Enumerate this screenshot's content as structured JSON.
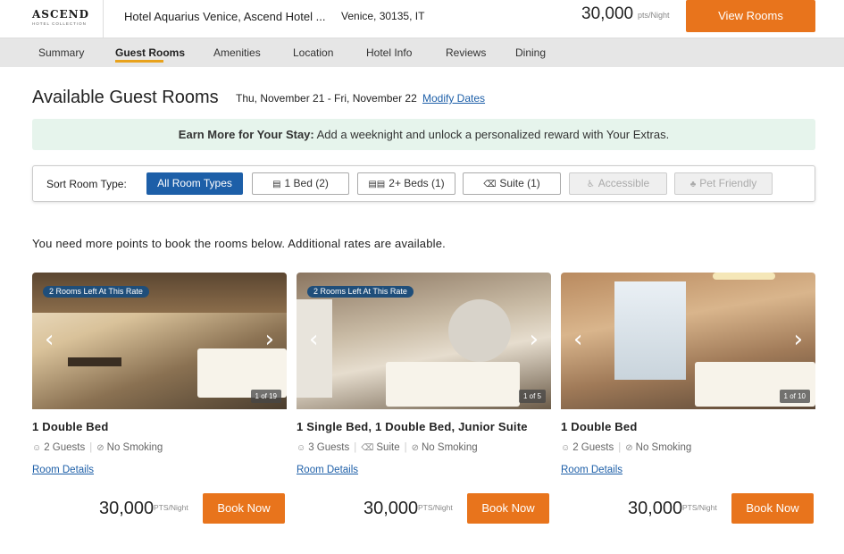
{
  "header": {
    "logo_main": "ASCEND",
    "logo_sub": "HOTEL COLLECTION",
    "hotel_name": "Hotel Aquarius Venice, Ascend Hotel ...",
    "location": "Venice, 30135, IT",
    "points": "30,000",
    "points_unit": "pts/Night",
    "view_rooms_label": "View Rooms"
  },
  "nav": {
    "items": [
      {
        "label": "Summary",
        "active": false
      },
      {
        "label": "Guest Rooms",
        "active": true
      },
      {
        "label": "Amenities",
        "active": false
      },
      {
        "label": "Location",
        "active": false
      },
      {
        "label": "Hotel Info",
        "active": false
      },
      {
        "label": "Reviews",
        "active": false
      },
      {
        "label": "Dining",
        "active": false
      }
    ]
  },
  "main": {
    "title": "Available Guest Rooms",
    "dates": "Thu, November 21 - Fri, November 22",
    "modify_dates": "Modify Dates",
    "banner_bold": "Earn More for Your Stay:",
    "banner_text": " Add a weeknight and unlock a personalized reward with Your Extras.",
    "sort_label": "Sort Room Type:",
    "filters": [
      {
        "label": "All Room Types",
        "icon": "",
        "state": "active"
      },
      {
        "label": "1 Bed (2)",
        "icon": "bed-icon",
        "state": "normal"
      },
      {
        "label": "2+ Beds (1)",
        "icon": "two-beds-icon",
        "state": "normal"
      },
      {
        "label": "Suite (1)",
        "icon": "sofa-icon",
        "state": "normal"
      },
      {
        "label": "Accessible",
        "icon": "wheelchair-icon",
        "state": "disabled"
      },
      {
        "label": "Pet Friendly",
        "icon": "pet-icon",
        "state": "disabled"
      }
    ],
    "need_points_msg": "You need more points to book the rooms below. Additional rates are available."
  },
  "rooms": [
    {
      "badge": "2 Rooms Left At This Rate",
      "counter": "1 of 19",
      "title": "1 Double Bed",
      "guests": "2 Guests",
      "suite": "",
      "smoking": "No Smoking",
      "details": "Room Details",
      "price": "30,000",
      "price_unit": "PTS/Night",
      "book": "Book Now"
    },
    {
      "badge": "2 Rooms Left At This Rate",
      "counter": "1 of 5",
      "title": "1 Single Bed, 1 Double Bed, Junior Suite",
      "guests": "3 Guests",
      "suite": "Suite",
      "smoking": "No Smoking",
      "details": "Room Details",
      "price": "30,000",
      "price_unit": "PTS/Night",
      "book": "Book Now"
    },
    {
      "badge": "",
      "counter": "1 of 10",
      "title": "1 Double Bed",
      "guests": "2 Guests",
      "suite": "",
      "smoking": "No Smoking",
      "details": "Room Details",
      "price": "30,000",
      "price_unit": "PTS/Night",
      "book": "Book Now"
    }
  ],
  "colors": {
    "accent_orange": "#e8741c",
    "link_blue": "#1d5fa8",
    "banner_green": "#e6f4ec",
    "badge_navy": "#1f4e7a"
  }
}
